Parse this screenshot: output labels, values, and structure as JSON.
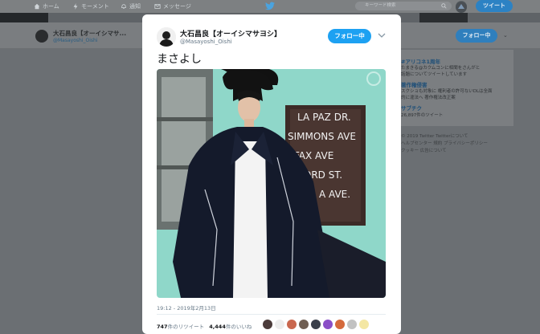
{
  "nav": {
    "home": "ホーム",
    "moments": "モーメント",
    "notifications": "通知",
    "messages": "メッセージ",
    "search_placeholder": "キーワード検索",
    "tweet_button": "ツイート"
  },
  "background_profile": {
    "name": "大石昌良【オーイシマサ...",
    "handle": "@Masayoshi_Oishi",
    "follow_label": "フォロー中"
  },
  "sidebar": {
    "trends": [
      {
        "tag": "#アリコネ1周年",
        "line1": "たまきる@カクムコンに相聞をさんがと",
        "line2": "話題についてツイートしています"
      },
      {
        "tag": "著作権侵害",
        "line1": "スクショも対象に 権利者の許可ないDLは全面",
        "line2": "的に違法へ 著作権法改正案"
      },
      {
        "tag": "サブチク",
        "line1": "26,897件のツイート",
        "line2": ""
      }
    ],
    "footer": [
      "© 2019 Twitter  Twitterについて",
      "ヘルプセンター  規約  プライバシーポリシー",
      "クッキー  広告について"
    ]
  },
  "tweet": {
    "name": "大石昌良【オーイシマサヨシ】",
    "handle": "@Masayoshi_Oishi",
    "follow_label": "フォロー中",
    "text": "まさよし",
    "timestamp": "19:12 - 2019年2月13日",
    "retweets": "747",
    "retweets_label": "件のリツイート",
    "likes": "4,444",
    "likes_label": "件のいいね",
    "photo_sign_lines": [
      "LA PAZ DR.",
      "SIMMONS AVE",
      "FAX AVE",
      "FORD ST.",
      "A AVE."
    ]
  },
  "colors": {
    "accent": "#1da1f2",
    "overlay_bg": "#6b6f73"
  }
}
